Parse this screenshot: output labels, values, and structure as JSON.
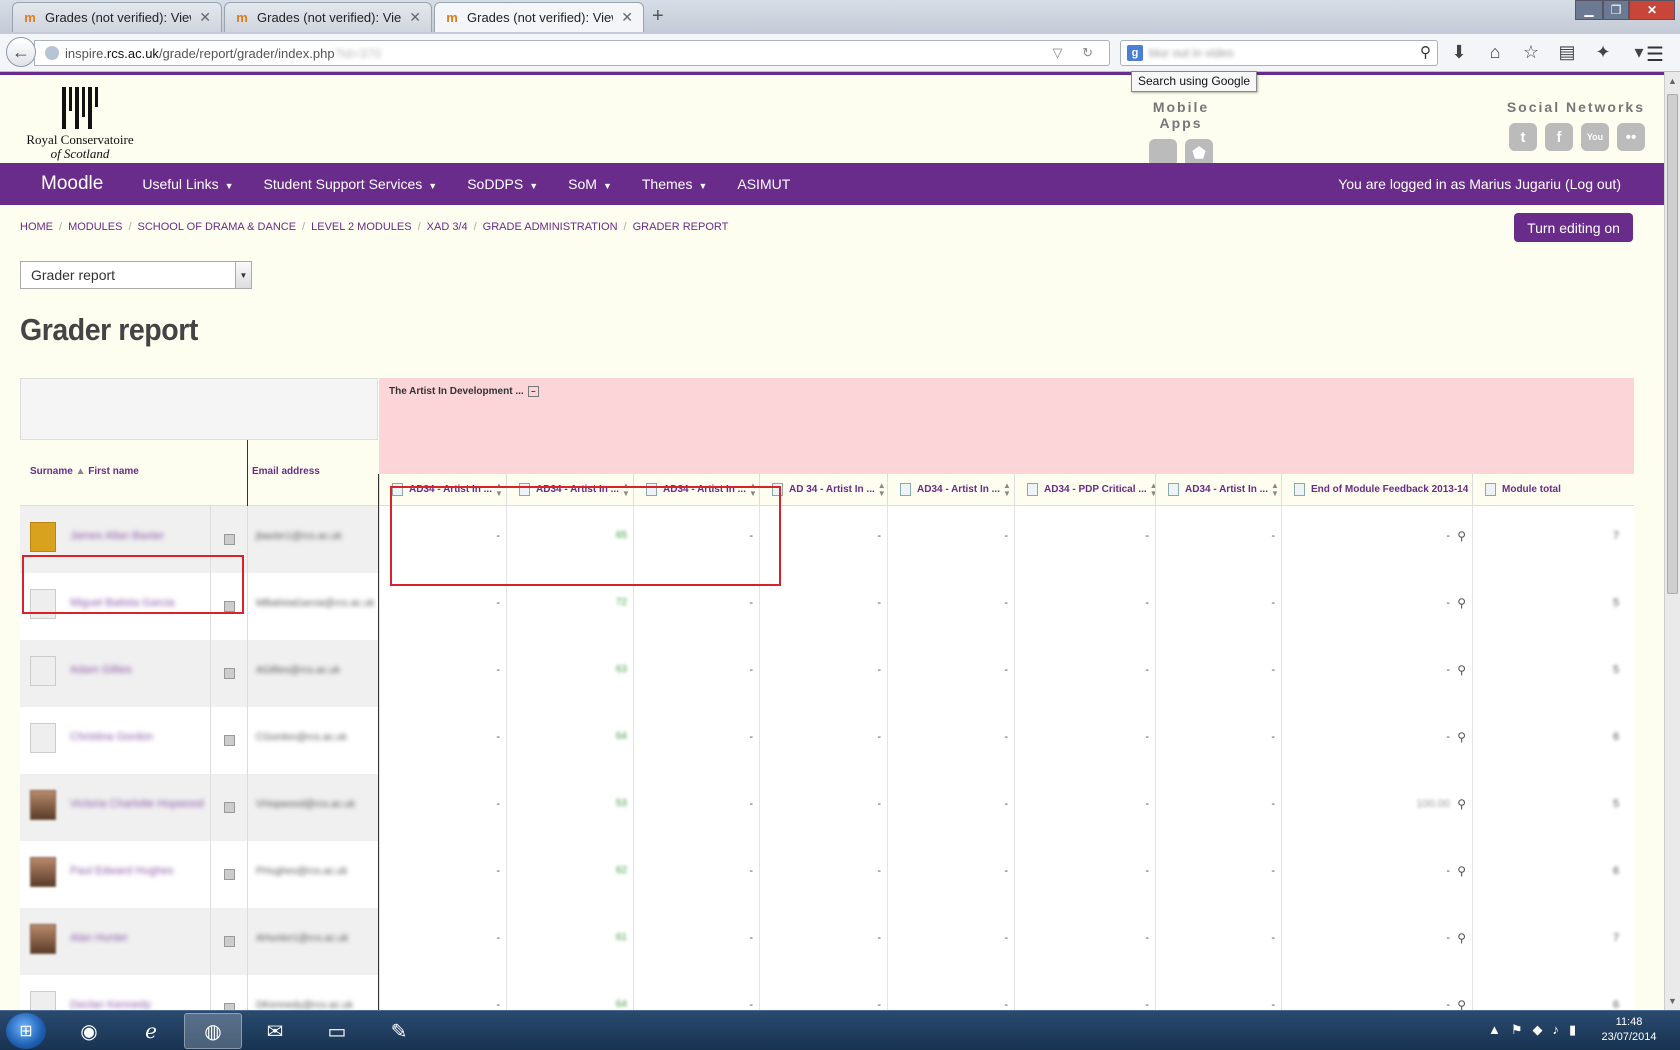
{
  "browser": {
    "tabs": [
      {
        "title": "Grades (not verified): View"
      },
      {
        "title": "Grades (not verified): View"
      },
      {
        "title": "Grades (not verified): View"
      }
    ],
    "url_prefix": "inspire.",
    "url_host": "rcs.ac.uk",
    "url_path": "/grade/report/grader/index.php",
    "url_blurred": "?id=370",
    "search_placeholder": "blur out in video",
    "search_tooltip": "Search using Google"
  },
  "header": {
    "logo_line1": "Royal Conservatoire",
    "logo_line2": "of Scotland",
    "mobile_apps": "Mobile Apps",
    "social_networks": "Social Networks",
    "icons": [
      "apple-icon",
      "android-icon",
      "twitter-icon",
      "facebook-icon",
      "youtube-icon",
      "flickr-icon"
    ]
  },
  "nav": {
    "brand": "Moodle",
    "items": [
      "Useful Links",
      "Student Support Services",
      "SoDDPS",
      "SoM",
      "Themes",
      "ASIMUT"
    ],
    "dropdown": [
      true,
      true,
      true,
      true,
      true,
      false
    ],
    "login": "You are logged in as Marius Jugariu (Log out)"
  },
  "breadcrumb": [
    "HOME",
    "MODULES",
    "SCHOOL OF DRAMA & DANCE",
    "LEVEL 2 MODULES",
    "XAD 3/4",
    "GRADE ADMINISTRATION",
    "GRADER REPORT"
  ],
  "edit_button": "Turn editing on",
  "report_select": "Grader report",
  "page_title": "Grader report",
  "table": {
    "col_surname": "Surname",
    "col_firstname": "First name",
    "col_email": "Email address",
    "category": "The Artist In Development ...",
    "items": [
      "AD34 - Artist In ...",
      "AD34 - Artist In ...",
      "AD34 - Artist In ...",
      "AD 34 - Artist In ...",
      "AD34 - Artist In ...",
      "AD34 - PDP Critical ...",
      "AD34 - Artist In ...",
      "End of Module Feedback 2013-14",
      "Module total"
    ],
    "rows": [
      {
        "name": "James Allan Baxter",
        "email": "jbaxter1@rcs.ac.uk",
        "grades": [
          "-",
          "65",
          "-",
          "-",
          "-",
          "-",
          "-",
          "-",
          "7"
        ]
      },
      {
        "name": "Miguel Batista Garcia",
        "email": "MBatistaGarcia@rcs.ac.uk",
        "grades": [
          "-",
          "72",
          "-",
          "-",
          "-",
          "-",
          "-",
          "-",
          "5"
        ]
      },
      {
        "name": "Adam Gillies",
        "email": "AGillies@rcs.ac.uk",
        "grades": [
          "-",
          "63",
          "-",
          "-",
          "-",
          "-",
          "-",
          "-",
          "5"
        ]
      },
      {
        "name": "Christina Gordon",
        "email": "CGordon@rcs.ac.uk",
        "grades": [
          "-",
          "64",
          "-",
          "-",
          "-",
          "-",
          "-",
          "-",
          "6"
        ]
      },
      {
        "name": "Victoria Charlotte Hopwood",
        "email": "VHopwood@rcs.ac.uk",
        "grades": [
          "-",
          "53",
          "-",
          "-",
          "-",
          "-",
          "-",
          "100.00",
          "5"
        ]
      },
      {
        "name": "Paul Edward Hughes",
        "email": "PHughes@rcs.ac.uk",
        "grades": [
          "-",
          "62",
          "-",
          "-",
          "-",
          "-",
          "-",
          "-",
          "6"
        ]
      },
      {
        "name": "Alan Hunter",
        "email": "AHunter1@rcs.ac.uk",
        "grades": [
          "-",
          "61",
          "-",
          "-",
          "-",
          "-",
          "-",
          "-",
          "7"
        ]
      },
      {
        "name": "Declan Kennedy",
        "email": "DKennedy@rcs.ac.uk",
        "grades": [
          "-",
          "64",
          "-",
          "-",
          "-",
          "-",
          "-",
          "-",
          "6"
        ]
      }
    ]
  },
  "taskbar": {
    "apps": [
      "chrome-icon",
      "ie-icon",
      "firefox-icon",
      "outlook-icon",
      "explorer-icon",
      "paint-icon"
    ],
    "time": "11:48",
    "date": "23/07/2014"
  }
}
